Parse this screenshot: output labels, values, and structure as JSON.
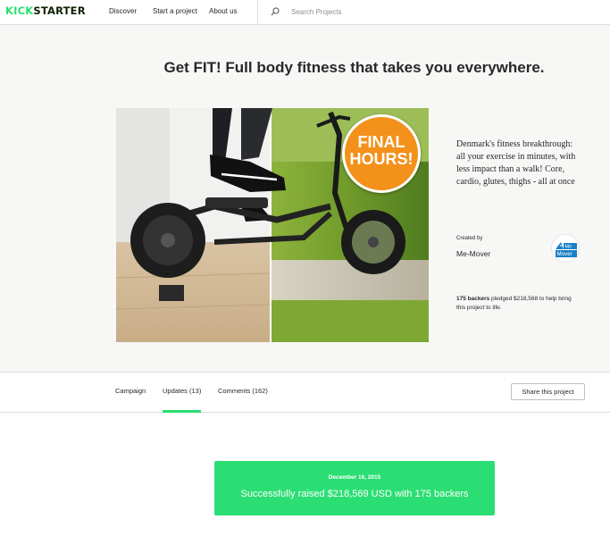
{
  "nav": {
    "logo_part1": "KICK",
    "logo_part2": "STARTER",
    "links": [
      "Discover",
      "Start a project",
      "About us"
    ],
    "search_placeholder": "Search Projects",
    "search_icon": "search-icon"
  },
  "project": {
    "title": "Get FIT! Full body fitness that takes you everywhere.",
    "video_badge_line1": "FINAL",
    "video_badge_line2": "HOURS!",
    "blurb": "Denmark's fitness breakthrough: all your exercise in minutes, with less impact than a walk! Core, cardio, glutes, thighs - all at once",
    "created_by_label": "Created by",
    "creator_name": "Me-Mover",
    "creator_logo_text": "Me Mover",
    "backers_count": "175 backers",
    "pledge_text": "pledged $218,568 to help bring this project to life."
  },
  "tabs": {
    "items": [
      "Campaign",
      "Updates (13)",
      "Comments (162)"
    ],
    "active": "Updates (13)",
    "share_label": "Share this project"
  },
  "banner": {
    "date": "December 16, 2015",
    "message": "Successfully raised $218,569 USD with 175 backers"
  },
  "colors": {
    "brand_green": "#2bde73",
    "logo_dark": "#0f2105",
    "badge_orange": "#f3911a",
    "creator_logo_blue": "#1b7fc4"
  }
}
